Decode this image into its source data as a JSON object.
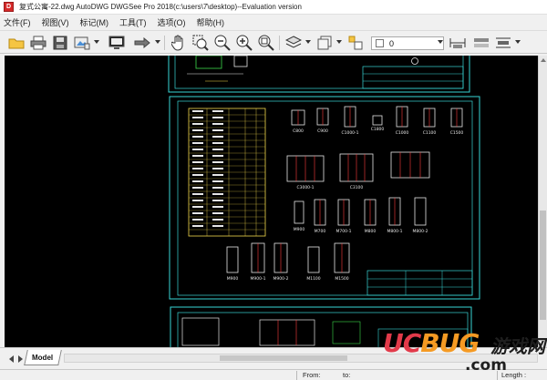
{
  "window": {
    "title": "复式公寓-22.dwg AutoDWG DWGSee Pro 2018(c:\\users\\7\\desktop)--Evaluation version",
    "app_icon_letter": "D"
  },
  "menu": {
    "items": [
      {
        "label": "文件(F)"
      },
      {
        "label": "视图(V)"
      },
      {
        "label": "标记(M)"
      },
      {
        "label": "工具(T)"
      },
      {
        "label": "选项(O)"
      },
      {
        "label": "帮助(H)"
      }
    ]
  },
  "toolbar": {
    "layer_value": "0",
    "icons": [
      "open-folder-icon",
      "print-icon",
      "save-icon",
      "export-image-icon",
      "monitor-icon",
      "arrow-right-icon",
      "pan-hand-icon",
      "zoom-window-icon",
      "zoom-out-icon",
      "zoom-in-icon",
      "zoom-extents-icon",
      "layer-icon",
      "color-square-icon",
      "layer-manager-icon",
      "measure-icon",
      "dimension-icon",
      "align-icon"
    ]
  },
  "drawing": {
    "window_labels": [
      "C800",
      "C900",
      "C1000-1",
      "C1800",
      "C1000",
      "C1100",
      "C1500",
      "C3000-1",
      "C3100"
    ],
    "door_labels": [
      "M900",
      "M700",
      "M700-1",
      "M800",
      "M800-1",
      "M800-2"
    ],
    "bottom_door_labels": [
      "M900",
      "M900-1",
      "M900-2",
      "M1100",
      "M1500"
    ],
    "colors": {
      "frame": "#38d6d6",
      "red": "#ff3b3b",
      "yellow": "#f2d84b",
      "white": "#e6e6e6",
      "green": "#3bd94a"
    }
  },
  "tabs": {
    "model_label": "Model"
  },
  "status": {
    "from_label": "From:",
    "to_label": "to:",
    "length_label": "Length :"
  },
  "watermark": {
    "logo_uc": "UC",
    "logo_bug": "BUG",
    "cn_text": "游戏网",
    "com_text": ".com"
  }
}
